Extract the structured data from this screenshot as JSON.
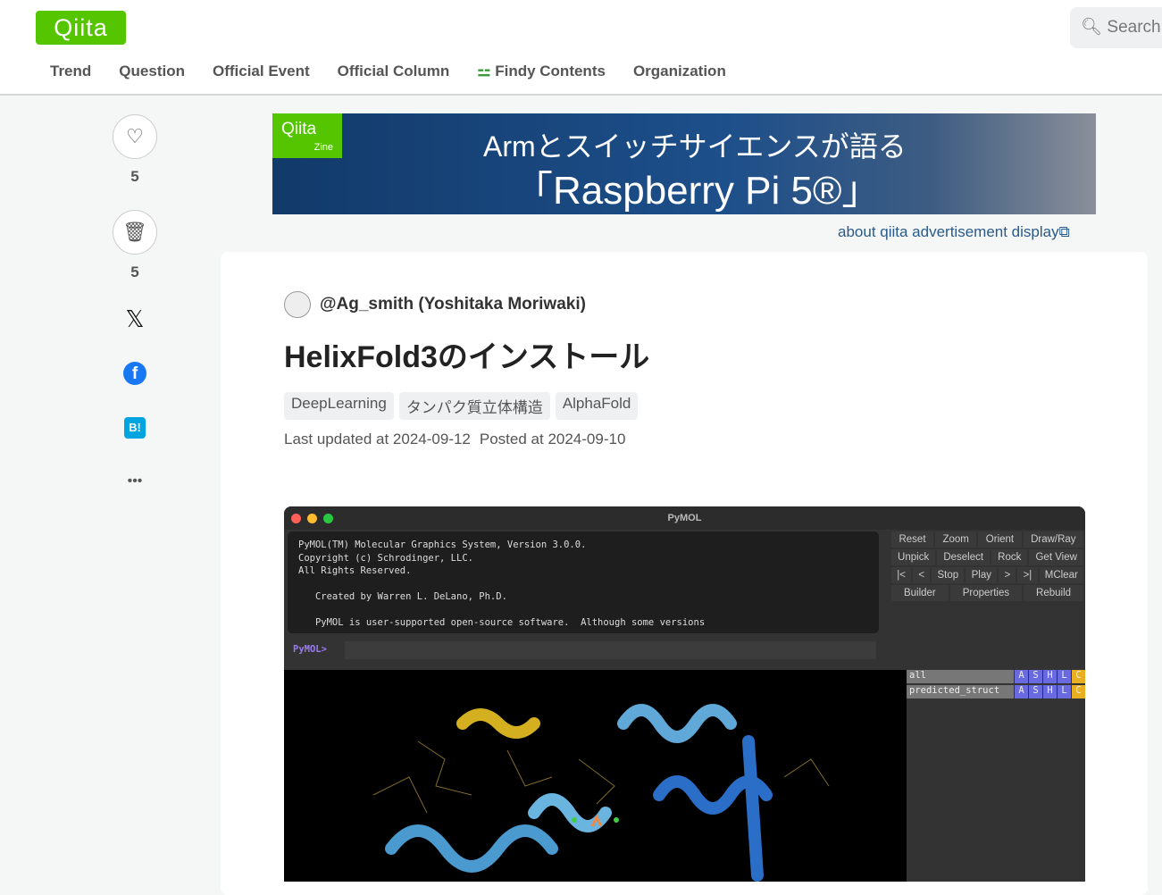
{
  "header": {
    "logo": "Qiita",
    "search_placeholder": "Search",
    "nav": [
      "Trend",
      "Question",
      "Official Event",
      "Official Column",
      "Findy Contents",
      "Organization"
    ]
  },
  "sidebar": {
    "like_count": "5",
    "stock_count": "5",
    "hatena_label": "B!",
    "more": "•••"
  },
  "banner": {
    "badge": "Qiita",
    "badge_sub": "Zine",
    "line1": "Armとスイッチサイエンスが語る",
    "line2": "「Raspberry Pi 5®」",
    "ad_link": "about qiita advertisement display"
  },
  "article": {
    "author": "@Ag_smith (Yoshitaka Moriwaki)",
    "title": "HelixFold3のインストール",
    "tags": [
      "DeepLearning",
      "タンパク質立体構造",
      "AlphaFold"
    ],
    "updated": "Last updated at 2024-09-12",
    "posted": "Posted at 2024-09-10"
  },
  "pymol": {
    "window_title": "PyMOL",
    "console": "PyMOL(TM) Molecular Graphics System, Version 3.0.0.\nCopyright (c) Schrodinger, LLC.\nAll Rights Reserved.\n\n   Created by Warren L. DeLano, Ph.D.\n\n   PyMOL is user-supported open-source software.  Although some versions",
    "prompt": "PyMOL>",
    "button_rows": [
      [
        "Reset",
        "Zoom",
        "Orient",
        "Draw/Ray"
      ],
      [
        "Unpick",
        "Deselect",
        "Rock",
        "Get View"
      ],
      [
        "|<",
        "<",
        "Stop",
        "Play",
        ">",
        ">|",
        "MClear"
      ],
      [
        "Builder",
        "Properties",
        "Rebuild"
      ]
    ],
    "objects": [
      "all",
      "predicted_struct"
    ],
    "obj_buttons": [
      "A",
      "S",
      "H",
      "L",
      "C"
    ]
  }
}
